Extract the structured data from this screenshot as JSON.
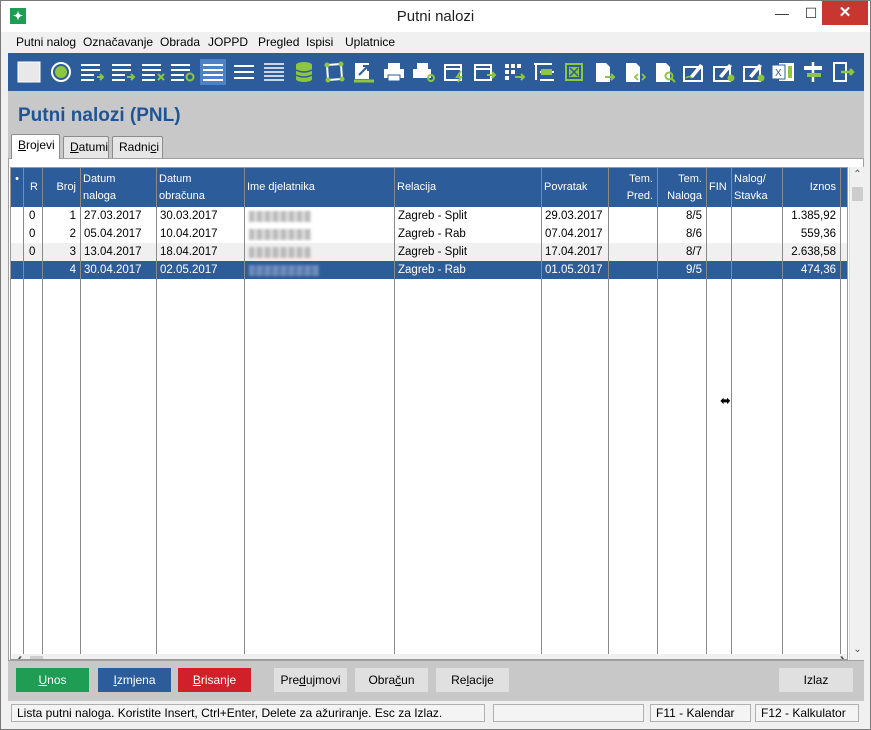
{
  "window": {
    "title": "Putni nalozi",
    "app_icon": "app-logo-icon"
  },
  "menu": [
    "Putni nalog",
    "Označavanje",
    "Obrada",
    "JOPPD",
    "Pregled",
    "Ispisi",
    "Uplatnice"
  ],
  "toolbar_icons": [
    "blank-box-icon",
    "circle-select-icon",
    "list-add-icon",
    "list-arrow-icon",
    "list-delete-icon",
    "list-refresh-icon",
    "list-view-icon",
    "lines-icon",
    "lines-dense-icon",
    "database-icon",
    "polygon-icon",
    "export-arrow-icon",
    "print-icon",
    "print-preview-icon",
    "calendar-flash-icon",
    "calendar-arrow-icon",
    "grid-arrow-icon",
    "tree-list-icon",
    "window-icon",
    "document-arrow-icon",
    "document-code-icon",
    "document-search-icon",
    "signature-icon",
    "signature-settings-icon",
    "signature-check-icon",
    "excel-icon",
    "signpost-icon",
    "exit-door-icon"
  ],
  "header": {
    "page_title": "Putni nalozi (PNL)"
  },
  "tabs": [
    {
      "label_pre": "",
      "label_u": "B",
      "label_post": "rojevi"
    },
    {
      "label_pre": "",
      "label_u": "D",
      "label_post": "atumi"
    },
    {
      "label_pre": "Radni",
      "label_u": "c",
      "label_post": "i"
    }
  ],
  "grid": {
    "columns": {
      "mark": "•",
      "r": "R",
      "broj": "Broj",
      "datum_naloga_1": "Datum",
      "datum_naloga_2": "naloga",
      "datum_obracuna_1": "Datum",
      "datum_obracuna_2": "obračuna",
      "ime": "Ime djelatnika",
      "relacija": "Relacija",
      "povratak": "Povratak",
      "tem_pred_1": "Tem.",
      "tem_pred_2": "Pred.",
      "tem_naloga_1": "Tem.",
      "tem_naloga_2": "Naloga",
      "fin": "FIN",
      "nalog_stavka_1": "Nalog/",
      "nalog_stavka_2": "Stavka",
      "iznos": "Iznos"
    },
    "rows": [
      {
        "r": "0",
        "broj": "1",
        "datum_naloga": "27.03.2017",
        "datum_obracuna": "30.03.2017",
        "relacija": "Zagreb - Split",
        "povratak": "29.03.2017",
        "tem_pred": "",
        "tem_naloga": "8/5",
        "fin": "",
        "nalog_stavka": "",
        "iznos": "1.385,92"
      },
      {
        "r": "0",
        "broj": "2",
        "datum_naloga": "05.04.2017",
        "datum_obracuna": "10.04.2017",
        "relacija": "Zagreb - Rab",
        "povratak": "07.04.2017",
        "tem_pred": "",
        "tem_naloga": "8/6",
        "fin": "",
        "nalog_stavka": "",
        "iznos": "559,36"
      },
      {
        "r": "0",
        "broj": "3",
        "datum_naloga": "13.04.2017",
        "datum_obracuna": "18.04.2017",
        "relacija": "Zagreb - Split",
        "povratak": "17.04.2017",
        "tem_pred": "",
        "tem_naloga": "8/7",
        "fin": "",
        "nalog_stavka": "",
        "iznos": "2.638,58"
      },
      {
        "r": "",
        "broj": "4",
        "datum_naloga": "30.04.2017",
        "datum_obracuna": "02.05.2017",
        "relacija": "Zagreb - Rab",
        "povratak": "01.05.2017",
        "tem_pred": "",
        "tem_naloga": "9/5",
        "fin": "",
        "nalog_stavka": "",
        "iznos": "474,36"
      }
    ]
  },
  "buttons": {
    "unos": {
      "pre": "",
      "u": "U",
      "post": "nos"
    },
    "izmjena": {
      "pre": "",
      "u": "I",
      "post": "zmjena"
    },
    "brisanje": {
      "pre": "",
      "u": "B",
      "post": "risanje"
    },
    "predujmovi": {
      "pre": "Pre",
      "u": "d",
      "post": "ujmovi"
    },
    "obracun": {
      "pre": "Obra",
      "u": "č",
      "post": "un"
    },
    "relacije": {
      "pre": "Re",
      "u": "l",
      "post": "acije"
    },
    "izlaz": "Izlaz"
  },
  "status": {
    "message": "Lista putni naloga. Koristite Insert, Ctrl+Enter, Delete za ažuriranje. Esc za Izlaz.",
    "empty": "",
    "f11": "F11 - Kalendar",
    "f12": "F12 - Kalkulator"
  },
  "colors": {
    "accent_blue": "#2d5c9a",
    "green": "#1f9d55",
    "red": "#d0202a",
    "title_blue": "#1f5596"
  }
}
